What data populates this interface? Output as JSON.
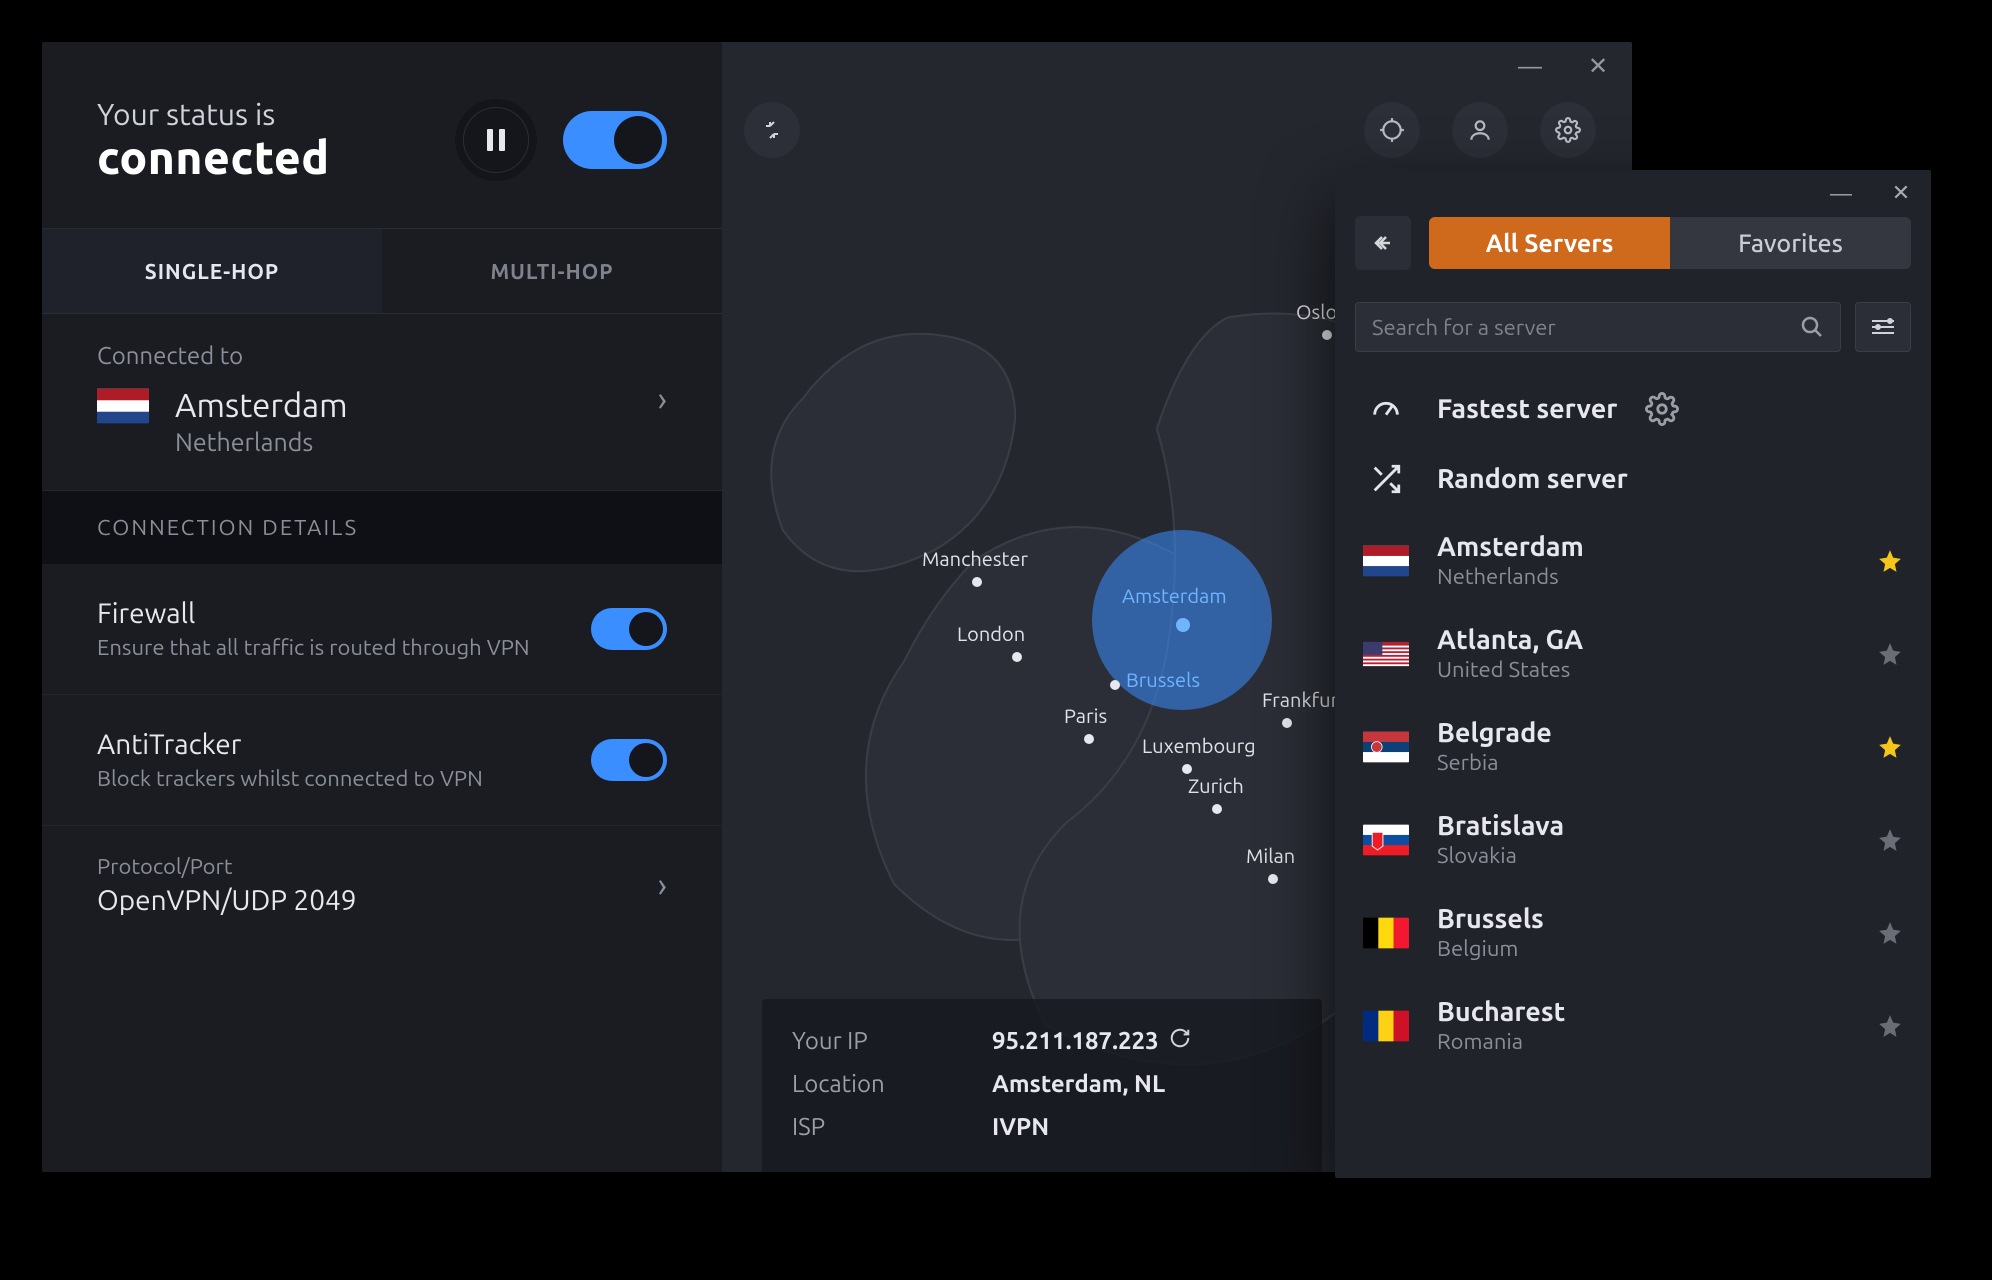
{
  "status": {
    "prefix": "Your status is",
    "value": "connected"
  },
  "tabs": {
    "single": "SINGLE-HOP",
    "multi": "MULTI-HOP"
  },
  "connected": {
    "label": "Connected to",
    "city": "Amsterdam",
    "country": "Netherlands"
  },
  "details_header": "CONNECTION DETAILS",
  "firewall": {
    "title": "Firewall",
    "sub": "Ensure that all traffic is routed through VPN"
  },
  "antitracker": {
    "title": "AntiTracker",
    "sub": "Block trackers whilst connected to VPN"
  },
  "protocol": {
    "label": "Protocol/Port",
    "value": "OpenVPN/UDP 2049"
  },
  "ipinfo": {
    "ip_label": "Your IP",
    "ip_value": "95.211.187.223",
    "loc_label": "Location",
    "loc_value": "Amsterdam, NL",
    "isp_label": "ISP",
    "isp_value": "IVPN"
  },
  "map_cities": {
    "oslo": "Oslo",
    "manchester": "Manchester",
    "london": "London",
    "amsterdam": "Amsterdam",
    "brussels": "Brussels",
    "paris": "Paris",
    "luxembourg": "Luxembourg",
    "frankfurt": "Frankfurt",
    "zurich": "Zurich",
    "milan": "Milan"
  },
  "search_placeholder": "Search for a server",
  "segment": {
    "all": "All Servers",
    "fav": "Favorites"
  },
  "fastest": "Fastest server",
  "random": "Random server",
  "servers": [
    {
      "city": "Amsterdam",
      "country": "Netherlands",
      "fav": true,
      "flag": "nl"
    },
    {
      "city": "Atlanta, GA",
      "country": "United States",
      "fav": false,
      "flag": "us"
    },
    {
      "city": "Belgrade",
      "country": "Serbia",
      "fav": true,
      "flag": "rs"
    },
    {
      "city": "Bratislava",
      "country": "Slovakia",
      "fav": false,
      "flag": "sk"
    },
    {
      "city": "Brussels",
      "country": "Belgium",
      "fav": false,
      "flag": "be"
    },
    {
      "city": "Bucharest",
      "country": "Romania",
      "fav": false,
      "flag": "ro"
    }
  ]
}
